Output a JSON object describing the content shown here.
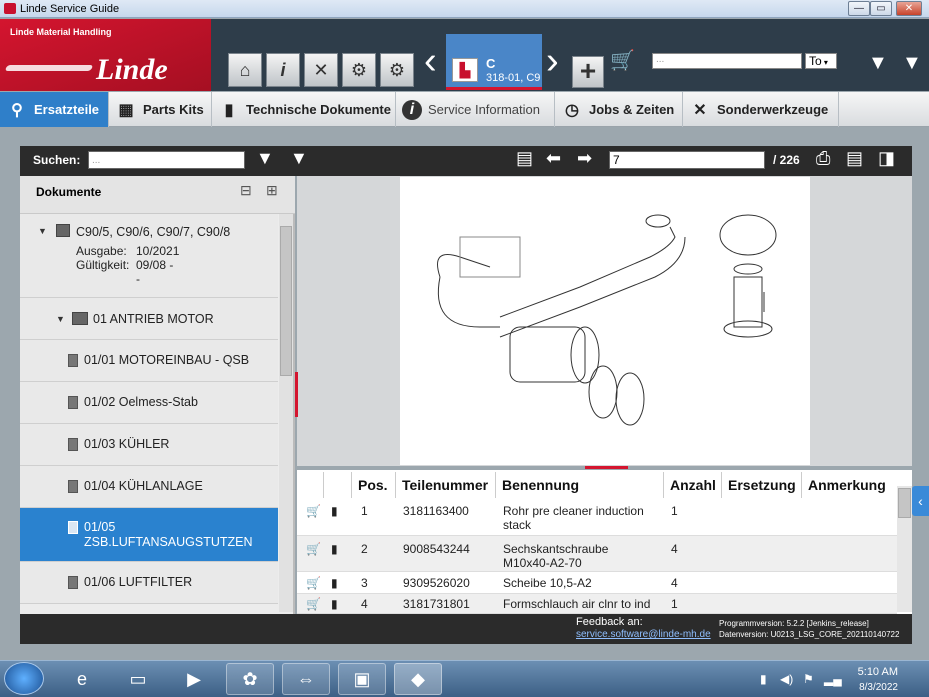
{
  "window": {
    "title": "Linde Service Guide",
    "controls": [
      "—",
      "▭",
      "✕"
    ]
  },
  "header": {
    "company": "Linde Material Handling",
    "brand": "Linde",
    "vehicle_tab": {
      "model": "C",
      "number": "318-01, C9"
    },
    "search_placeholder": "...",
    "search_scope": "To"
  },
  "tabs": [
    {
      "label": "Ersatzteile",
      "icon": "parts-icon",
      "active": true
    },
    {
      "label": "Parts Kits",
      "icon": "kits-icon",
      "active": false
    },
    {
      "label": "Technische Dokumente",
      "icon": "document-icon",
      "active": false
    },
    {
      "label": "Service Information",
      "icon": "info-icon",
      "active": false
    },
    {
      "label": "Jobs & Zeiten",
      "icon": "clock-icon",
      "active": false
    },
    {
      "label": "Sonderwerkzeuge",
      "icon": "tools-icon",
      "active": false
    }
  ],
  "toolbar": {
    "search_label": "Suchen:",
    "search_value": "...",
    "page_current": "7",
    "page_total": "/ 226"
  },
  "sidebar": {
    "header": "Dokumente",
    "model": "C90/5, C90/6, C90/7, C90/8",
    "ausgabe_label": "Ausgabe:",
    "ausgabe_value": "10/2021",
    "gueltigkeit_label": "Gültigkeit:",
    "gueltigkeit_value": "09/08 -",
    "gueltigkeit_extra": "-",
    "group": "01 ANTRIEB MOTOR",
    "items": [
      {
        "label": "01/01 MOTOREINBAU - QSB"
      },
      {
        "label": "01/02 Oelmess-Stab"
      },
      {
        "label": "01/03 KÜHLER"
      },
      {
        "label": "01/04 KÜHLANLAGE"
      },
      {
        "label": "01/05",
        "label2": "ZSB.LUFTANSAUGSTUTZEN",
        "selected": true
      },
      {
        "label": "01/06 LUFTFILTER"
      }
    ]
  },
  "table": {
    "headers": [
      "Pos.",
      "Teilenummer",
      "Benennung",
      "Anzahl",
      "Ersetzung",
      "Anmerkung"
    ],
    "rows": [
      {
        "pos": "1",
        "part": "3181163400",
        "name": "Rohr pre cleaner induction stack",
        "qty": "1"
      },
      {
        "pos": "2",
        "part": "9008543244",
        "name": "Sechskantschraube M10x40-A2-70",
        "qty": "4"
      },
      {
        "pos": "3",
        "part": "9309526020",
        "name": "Scheibe 10,5-A2",
        "qty": "4"
      },
      {
        "pos": "4",
        "part": "3181731801",
        "name": "Formschlauch air clnr to ind",
        "qty": "1"
      }
    ]
  },
  "footer": {
    "feedback_label": "Feedback an:",
    "feedback_email": "service.software@linde-mh.de",
    "program_version": "Programmversion: 5.2.2 [Jenkins_release]",
    "data_version": "Datenversion: U0213_LSG_CORE_202110140722"
  },
  "taskbar": {
    "time": "5:10 AM",
    "date": "8/3/2022"
  },
  "colors": {
    "accent": "#2a82cf",
    "brand": "#d4152f"
  }
}
